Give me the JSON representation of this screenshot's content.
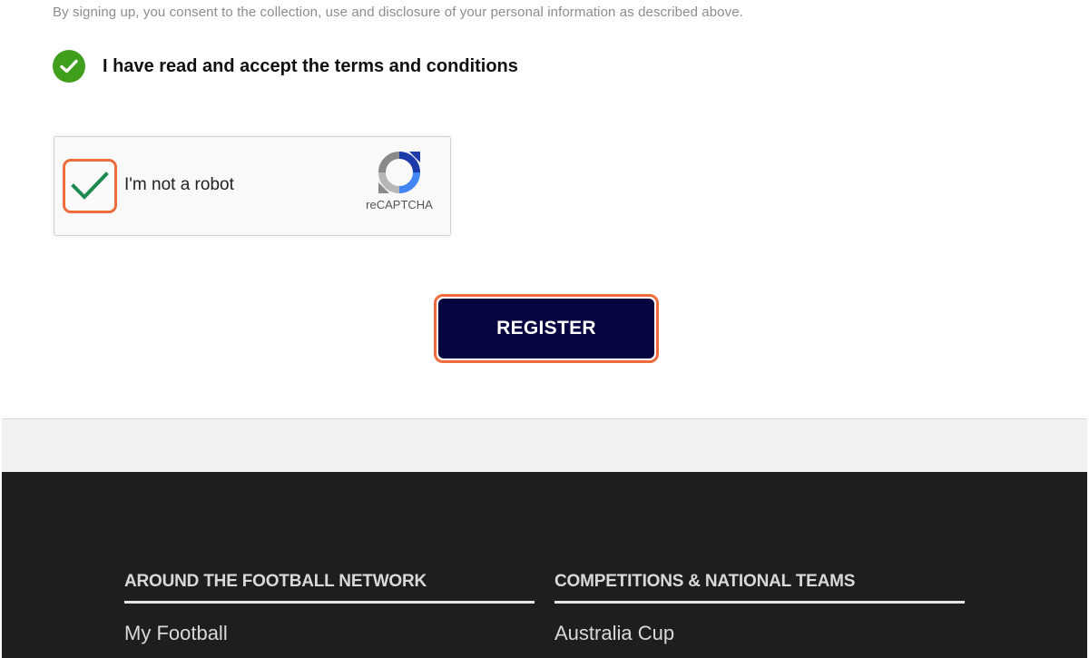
{
  "form": {
    "consent_text": "By signing up, you consent to the collection, use and disclosure of your personal information as described above.",
    "terms_label": "I have read and accept the terms and conditions",
    "terms_checked": true
  },
  "recaptcha": {
    "label": "I'm not a robot",
    "brand": "reCAPTCHA",
    "checked": true
  },
  "actions": {
    "register_label": "REGISTER"
  },
  "footer": {
    "columns": [
      {
        "heading": "AROUND THE FOOTBALL NETWORK",
        "links": [
          "My Football"
        ]
      },
      {
        "heading": "COMPETITIONS & NATIONAL TEAMS",
        "links": [
          "Australia Cup"
        ]
      }
    ]
  },
  "colors": {
    "check_green": "#3f9e1b",
    "highlight_orange": "#ef6c3c",
    "button_navy": "#07053f",
    "footer_bg": "#1e1e1e"
  }
}
